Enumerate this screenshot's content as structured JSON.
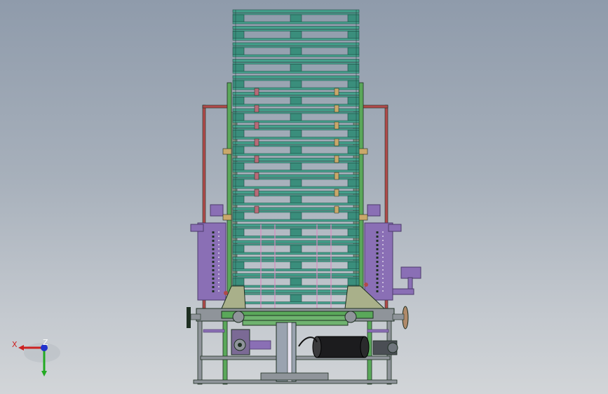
{
  "viewport": {
    "background_top": "#8f9bab",
    "background_bottom": "#d2d5d8"
  },
  "model": {
    "colors": {
      "pallet_board": "#45a08c",
      "pallet_board_edge": "#1f4d45",
      "pallet_block": "#3a8e7c",
      "frame_green": "#5aa85a",
      "frame_dark": "#1e2f22",
      "purple": "#8a6fb5",
      "purple_dark": "#4c3b6b",
      "red_frame": "#b04a4a",
      "tan_guide": "#c9a86a",
      "steel": "#8f949a",
      "motor_black": "#1c1c1e",
      "chain_light": "#d9d3e8"
    }
  },
  "triad": {
    "x_label": "X",
    "z_label": "Z",
    "x_color": "#cc2222",
    "y_color": "#22aa22",
    "z_color": "#2233cc"
  }
}
